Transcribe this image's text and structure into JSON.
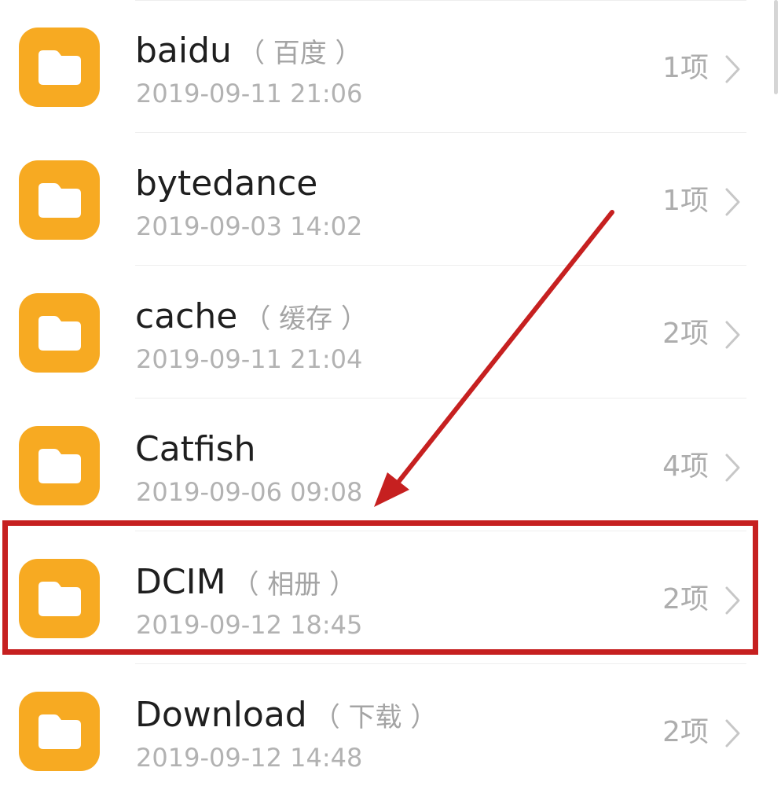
{
  "folders": [
    {
      "name": "baidu",
      "alias": "（ 百度 ）",
      "date": "2019-09-11 21:06",
      "count": "1项"
    },
    {
      "name": "bytedance",
      "alias": "",
      "date": "2019-09-03 14:02",
      "count": "1项"
    },
    {
      "name": "cache",
      "alias": "（ 缓存 ）",
      "date": "2019-09-11 21:04",
      "count": "2项"
    },
    {
      "name": "Catfish",
      "alias": "",
      "date": "2019-09-06 09:08",
      "count": "4项"
    },
    {
      "name": "DCIM",
      "alias": "（ 相册 ）",
      "date": "2019-09-12 18:45",
      "count": "2项"
    },
    {
      "name": "Download",
      "alias": "（ 下载 ）",
      "date": "2019-09-12 14:48",
      "count": "2项"
    }
  ],
  "colors": {
    "folder_icon": "#f7aa22",
    "annotation": "#c62020",
    "primary_text": "#1f1f1f",
    "secondary_text": "#b2b2b2"
  },
  "icons": {
    "folder": "folder-icon",
    "chevron": "chevron-right-icon",
    "annotation": "annotation-arrow"
  }
}
